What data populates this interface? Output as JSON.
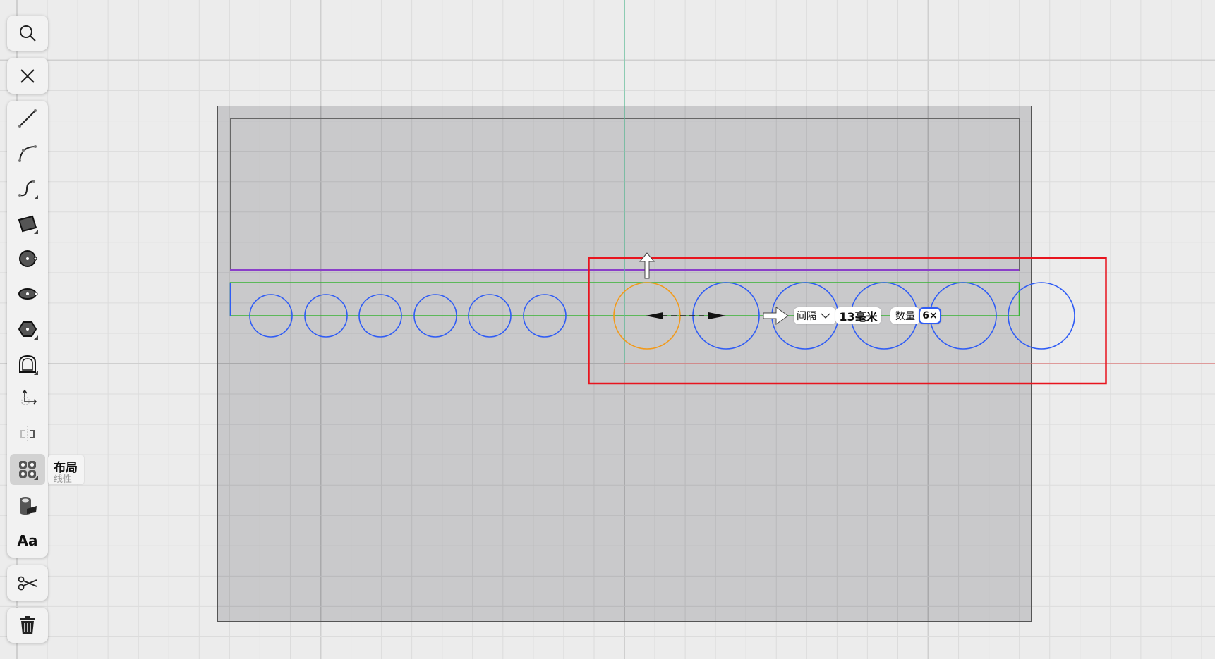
{
  "toolbar": {
    "top_buttons": [
      {
        "icon": "search-icon"
      },
      {
        "icon": "close-icon"
      }
    ],
    "tools": [
      {
        "icon": "line-icon"
      },
      {
        "icon": "arc-icon"
      },
      {
        "icon": "spline-icon"
      },
      {
        "icon": "rectangle-icon"
      },
      {
        "icon": "circle-icon"
      },
      {
        "icon": "ellipse-icon"
      },
      {
        "icon": "polygon-icon"
      },
      {
        "icon": "shape-icon"
      },
      {
        "icon": "move-icon"
      },
      {
        "icon": "mirror-icon"
      },
      {
        "icon": "layout-icon",
        "active": true
      },
      {
        "icon": "fill-icon"
      },
      {
        "icon": "text-icon",
        "label": "Aa"
      }
    ],
    "bottom_buttons": [
      {
        "icon": "scissors-icon"
      },
      {
        "icon": "trash-icon"
      }
    ]
  },
  "tooltip": {
    "title": "布局",
    "subtitle": "线性"
  },
  "layout_controls": {
    "mode_label": "间隔",
    "spacing_value": "13毫米",
    "count_label": "数量",
    "count_value": "6×"
  },
  "colors": {
    "existing_circles": "#2f5cf5",
    "selected_circle": "#f29a1a",
    "guide_green": "#39b335",
    "guide_purple": "#8a3fc9",
    "selection_box": "#e8141e",
    "axis_y": "#5fc9a0",
    "axis_x": "#e87a7a"
  }
}
